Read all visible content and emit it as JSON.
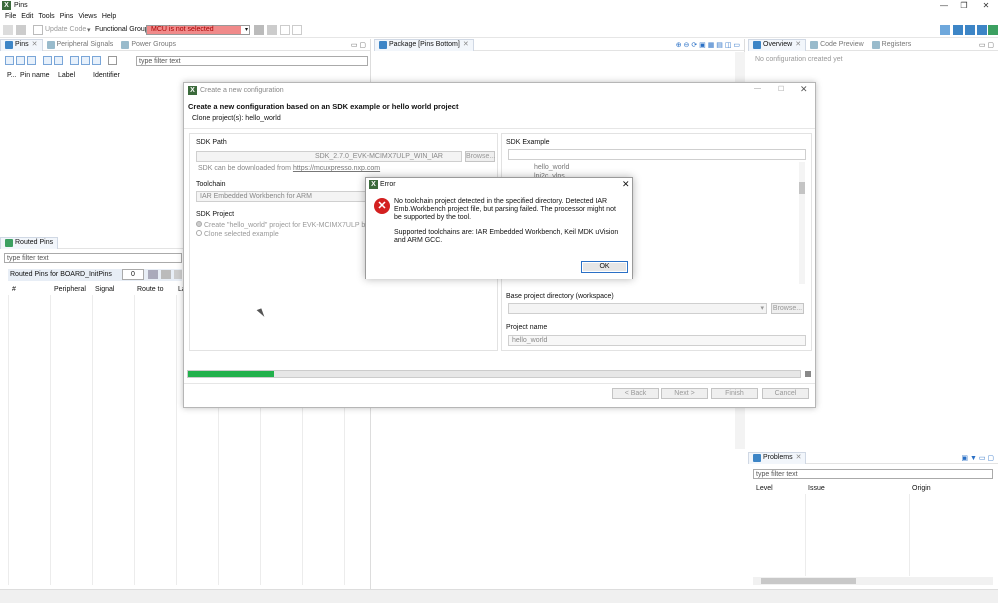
{
  "window": {
    "title": "Pins",
    "minimize": "—",
    "restore": "❐",
    "close": "✕"
  },
  "menu": [
    "File",
    "Edit",
    "Tools",
    "Pins",
    "Views",
    "Help"
  ],
  "toolbar": {
    "update_code": "Update Code",
    "functional_group_label": "Functional Group",
    "mcu_status": "MCU is not selected"
  },
  "pins_panel": {
    "tabs": [
      "Pins",
      "Peripheral Signals",
      "Power Groups"
    ],
    "filter_placeholder": "type filter text",
    "columns": [
      "P...",
      "Pin name",
      "Label",
      "Identifier"
    ]
  },
  "package_panel": {
    "tab": "Package [Pins Bottom]"
  },
  "overview_panel": {
    "tabs": [
      "Overview",
      "Code Preview",
      "Registers"
    ],
    "empty_text": "No configuration created yet"
  },
  "routed_panel": {
    "tab": "Routed Pins",
    "filter_placeholder": "type filter text",
    "group_label": "Routed Pins for BOARD_InitPins",
    "count": "0",
    "columns": [
      "#",
      "Peripheral",
      "Signal",
      "Route to",
      "La"
    ]
  },
  "problems_panel": {
    "tab": "Problems",
    "filter_placeholder": "type filter text",
    "columns": [
      "Level",
      "Issue",
      "Origin"
    ]
  },
  "config_dialog": {
    "window_title": "Create a new configuration",
    "heading": "Create a new configuration based on an SDK example or hello world project",
    "clone_line": "Clone project(s): hello_world",
    "sdk_path_label": "SDK Path",
    "sdk_path_value": "SDK_2.7.0_EVK-MCIMX7ULP_WIN_IAR",
    "browse": "Browse...",
    "download_text": "SDK can be downloaded from",
    "download_link": "https://mcuxpresso.nxp.com",
    "toolchain_label": "Toolchain",
    "toolchain_value": "IAR Embedded Workbench for ARM",
    "sdk_project_label": "SDK Project",
    "radio_create": "Create \"hello_world\" project for EVK-MCIMX7ULP board",
    "radio_clone": "Clone selected example",
    "sdk_example_label": "SDK Example",
    "examples": [
      "hello_world",
      "lpi2c_vlps"
    ],
    "base_dir_label": "Base project directory (workspace)",
    "project_name_label": "Project name",
    "project_name_value": "hello_world",
    "progress": 0.14,
    "buttons": {
      "back": "< Back",
      "next": "Next >",
      "finish": "Finish",
      "cancel": "Cancel"
    }
  },
  "error_dialog": {
    "title": "Error",
    "message1": "No toolchain project detected in the specified directory. Detected IAR Emb.Workbench project file, but parsing failed. The processor might not be supported by the tool.",
    "message2": "Supported toolchains are: IAR Embedded Workbench, Keil MDK uVision and ARM GCC.",
    "ok": "OK"
  },
  "colors": {
    "accent": "#2a70c6",
    "progress": "#22b14c",
    "mcu_bg": "#f08a8a",
    "error_red": "#d32020"
  }
}
